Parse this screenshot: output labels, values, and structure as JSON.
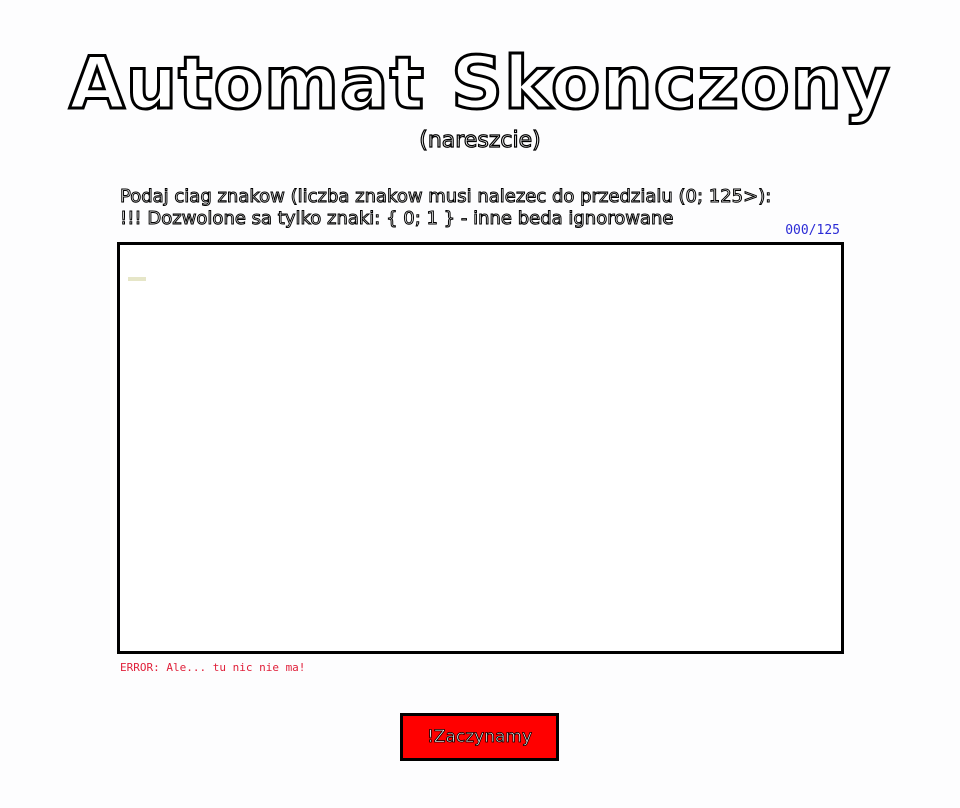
{
  "header": {
    "title": "Automat Skonczony",
    "subtitle": "(nareszcie)"
  },
  "instructions": {
    "line1": "Podaj ciag znakow (liczba znakow musi nalezec do przedzialu (0; 125>):",
    "line2": "!!! Dozwolone sa tylko znaki: { 0; 1 } - inne beda ignorowane"
  },
  "input": {
    "counter": "000/125",
    "value": "",
    "placeholder": ""
  },
  "error": {
    "message": "ERROR: Ale... tu nic nie ma!"
  },
  "actions": {
    "start_label": "!Zaczynamy"
  },
  "colors": {
    "error": "#e0203a",
    "counter": "#2b2bd6",
    "button_bg": "#ff0000"
  }
}
